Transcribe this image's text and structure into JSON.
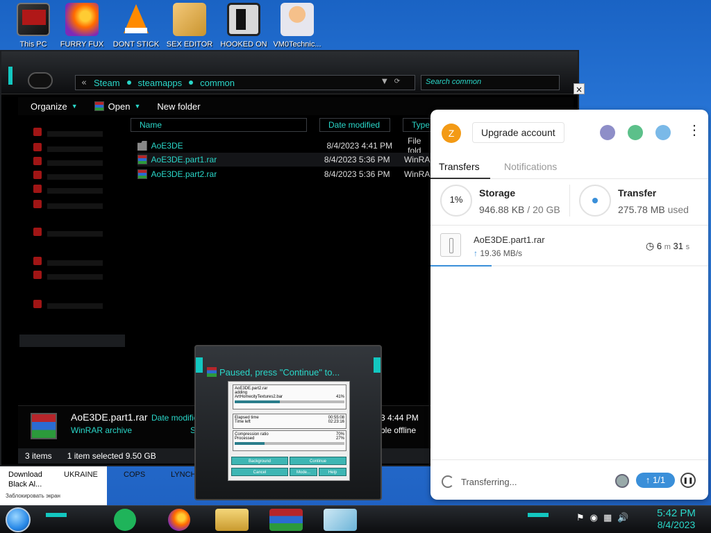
{
  "desktop_icons": [
    {
      "label": "This PC",
      "icon": "computer-icon"
    },
    {
      "label": "FURRY FUX",
      "icon": "firefox-icon"
    },
    {
      "label": "DONT STICK",
      "icon": "vlc-icon"
    },
    {
      "label": "SEX EDITOR",
      "icon": "hxd-icon"
    },
    {
      "label": "HOOKED ON",
      "icon": "app-icon"
    },
    {
      "label": "VM0Technic...",
      "icon": "doctor-icon"
    }
  ],
  "explorer": {
    "breadcrumb": [
      "Steam",
      "steamapps",
      "common"
    ],
    "search_placeholder": "Search common",
    "toolbar": {
      "organize": "Organize",
      "open": "Open",
      "new_folder": "New folder"
    },
    "columns": {
      "name": "Name",
      "date": "Date modified",
      "type": "Type"
    },
    "files": [
      {
        "name": "AoE3DE",
        "date": "8/4/2023 4:41 PM",
        "type": "File fold",
        "icon": "folder-icon"
      },
      {
        "name": "AoE3DE.part1.rar",
        "date": "8/4/2023 5:36 PM",
        "type": "WinRAR",
        "icon": "winrar-icon"
      },
      {
        "name": "AoE3DE.part2.rar",
        "date": "8/4/2023 5:36 PM",
        "type": "WinRAR",
        "icon": "winrar-icon"
      }
    ],
    "details": {
      "name": "AoE3DE.part1.rar",
      "type": "WinRAR archive",
      "modified_label": "Date modifie",
      "size_label": "Siz",
      "time": "3 4:44 PM",
      "offline": "ble offline"
    },
    "status": {
      "items": "3 items",
      "selected": "1 item selected  9.50 GB"
    }
  },
  "widget": {
    "line1": "Download",
    "line2": "Black Al...",
    "line3": "Заблокировать экран",
    "tabs": [
      "UKRAINE",
      "COPS",
      "LYNCH"
    ]
  },
  "winrar": {
    "title": "Paused, press \"Continue\" to...",
    "archive": "AoE3DE.part2.rar",
    "action": "adding",
    "file": "ArtHomecityTextures2.bar",
    "file_percent": "41%",
    "file_progress": 0.41,
    "elapsed_label": "Elapsed time",
    "elapsed": "00:55:08",
    "left_label": "Time left",
    "left": "02:23:16",
    "ratio_label": "Compression ratio",
    "ratio": "70%",
    "processed_label": "Processed",
    "processed": "27%",
    "processed_progress": 0.27,
    "buttons": {
      "background": "Background",
      "continue": "Continue",
      "cancel": "Cancel",
      "mode": "Mode...",
      "help": "Help"
    }
  },
  "mega": {
    "avatar": "Z",
    "upgrade": "Upgrade account",
    "tabs": {
      "transfers": "Transfers",
      "notifications": "Notifications"
    },
    "storage": {
      "label": "Storage",
      "percent": "1%",
      "used": "946.88 KB",
      "sep": " / ",
      "total": "20 GB"
    },
    "transfer": {
      "label": "Transfer",
      "used": "275.78 MB",
      "suffix": " used"
    },
    "item": {
      "name": "AoE3DE.part1.rar",
      "speed": "19.36 MB/s",
      "min": "6",
      "min_unit": "m",
      "sec": "31",
      "sec_unit": "s",
      "progress": 0.22
    },
    "footer": {
      "status": "Transferring...",
      "count": "1/1"
    }
  },
  "taskbar": {
    "time": "5:42 PM",
    "date": "8/4/2023"
  },
  "colors": {
    "accent": "#2ad7c9",
    "mega_blue": "#3a8fd9",
    "avatar": "#f39a15"
  }
}
